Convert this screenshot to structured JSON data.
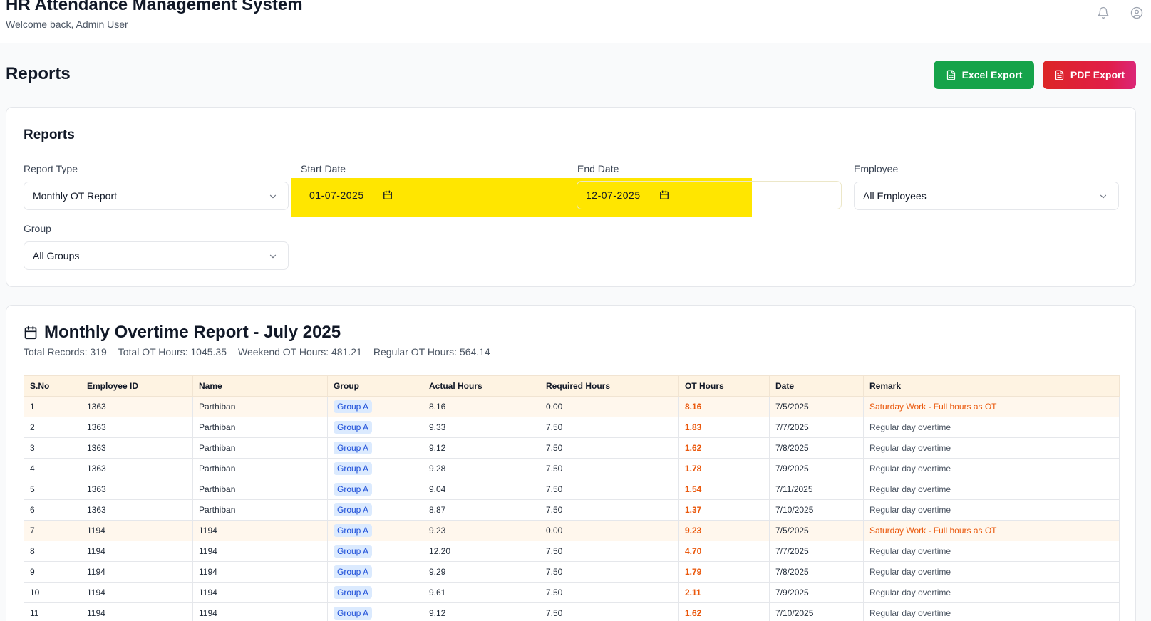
{
  "app": {
    "title": "HR Attendance Management System",
    "welcome": "Welcome back, Admin User",
    "icons": [
      "bell-icon",
      "user-circle-icon"
    ]
  },
  "page": {
    "title": "Reports",
    "excel_export_label": "Excel Export",
    "pdf_export_label": "PDF Export"
  },
  "filters": {
    "card_title": "Reports",
    "report_type": {
      "label": "Report Type",
      "value": "Monthly OT Report"
    },
    "start_date": {
      "label": "Start Date",
      "value": "01-07-2025"
    },
    "end_date": {
      "label": "End Date",
      "value": "12-07-2025"
    },
    "employee": {
      "label": "Employee",
      "value": "All Employees"
    },
    "group": {
      "label": "Group",
      "value": "All Groups"
    }
  },
  "report": {
    "title": "Monthly Overtime Report - July 2025",
    "stats": {
      "total_records": "Total Records: 319",
      "total_ot": "Total OT Hours: 1045.35",
      "weekend_ot": "Weekend OT Hours: 481.21",
      "regular_ot": "Regular OT Hours: 564.14"
    },
    "columns": [
      "S.No",
      "Employee ID",
      "Name",
      "Group",
      "Actual Hours",
      "Required Hours",
      "OT Hours",
      "Date",
      "Remark"
    ],
    "rows": [
      {
        "sno": "1",
        "employee_id": "1363",
        "name": "Parthiban",
        "group": "Group A",
        "actual": "8.16",
        "required": "0.00",
        "ot": "8.16",
        "date": "7/5/2025",
        "remark": "Saturday Work - Full hours as OT",
        "weekend": true
      },
      {
        "sno": "2",
        "employee_id": "1363",
        "name": "Parthiban",
        "group": "Group A",
        "actual": "9.33",
        "required": "7.50",
        "ot": "1.83",
        "date": "7/7/2025",
        "remark": "Regular day overtime",
        "weekend": false
      },
      {
        "sno": "3",
        "employee_id": "1363",
        "name": "Parthiban",
        "group": "Group A",
        "actual": "9.12",
        "required": "7.50",
        "ot": "1.62",
        "date": "7/8/2025",
        "remark": "Regular day overtime",
        "weekend": false
      },
      {
        "sno": "4",
        "employee_id": "1363",
        "name": "Parthiban",
        "group": "Group A",
        "actual": "9.28",
        "required": "7.50",
        "ot": "1.78",
        "date": "7/9/2025",
        "remark": "Regular day overtime",
        "weekend": false
      },
      {
        "sno": "5",
        "employee_id": "1363",
        "name": "Parthiban",
        "group": "Group A",
        "actual": "9.04",
        "required": "7.50",
        "ot": "1.54",
        "date": "7/11/2025",
        "remark": "Regular day overtime",
        "weekend": false
      },
      {
        "sno": "6",
        "employee_id": "1363",
        "name": "Parthiban",
        "group": "Group A",
        "actual": "8.87",
        "required": "7.50",
        "ot": "1.37",
        "date": "7/10/2025",
        "remark": "Regular day overtime",
        "weekend": false
      },
      {
        "sno": "7",
        "employee_id": "1194",
        "name": "1194",
        "group": "Group A",
        "actual": "9.23",
        "required": "0.00",
        "ot": "9.23",
        "date": "7/5/2025",
        "remark": "Saturday Work - Full hours as OT",
        "weekend": true
      },
      {
        "sno": "8",
        "employee_id": "1194",
        "name": "1194",
        "group": "Group A",
        "actual": "12.20",
        "required": "7.50",
        "ot": "4.70",
        "date": "7/7/2025",
        "remark": "Regular day overtime",
        "weekend": false
      },
      {
        "sno": "9",
        "employee_id": "1194",
        "name": "1194",
        "group": "Group A",
        "actual": "9.29",
        "required": "7.50",
        "ot": "1.79",
        "date": "7/8/2025",
        "remark": "Regular day overtime",
        "weekend": false
      },
      {
        "sno": "10",
        "employee_id": "1194",
        "name": "1194",
        "group": "Group A",
        "actual": "9.61",
        "required": "7.50",
        "ot": "2.11",
        "date": "7/9/2025",
        "remark": "Regular day overtime",
        "weekend": false
      },
      {
        "sno": "11",
        "employee_id": "1194",
        "name": "1194",
        "group": "Group A",
        "actual": "9.12",
        "required": "7.50",
        "ot": "1.62",
        "date": "7/10/2025",
        "remark": "Regular day overtime",
        "weekend": false
      }
    ]
  },
  "colors": {
    "excel_green": "#16a34a",
    "pdf_red": "#dc2626",
    "highlight_yellow": "#ffe600",
    "ot_orange": "#ea580c",
    "header_bg": "#fef3e2",
    "group_badge_bg": "#dbeafe"
  }
}
